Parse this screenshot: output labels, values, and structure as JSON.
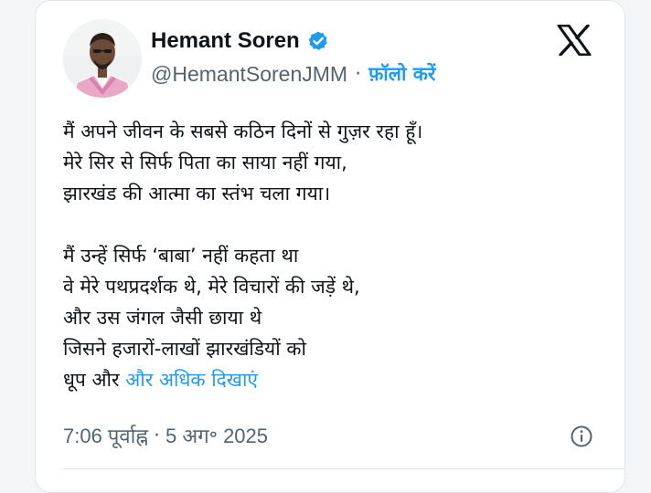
{
  "author": {
    "name": "Hemant Soren",
    "handle": "@HemantSorenJMM",
    "separator": "·",
    "follow_label": "फ़ॉलो करें",
    "verified_color": "#1d9bf0"
  },
  "tweet": {
    "lines": [
      "मैं अपने जीवन के सबसे कठिन दिनों से गुज़र रहा हूँ।",
      "मेरे सिर से सिर्फ पिता का साया नहीं गया,",
      "झारखंड की आत्मा का स्तंभ चला गया।",
      "",
      "मैं उन्हें सिर्फ ‘बाबा’ नहीं कहता था",
      "वे मेरे पथप्रदर्शक थे, मेरे विचारों की जड़ें थे,",
      "और उस जंगल जैसी छाया थे",
      "जिसने हजारों-लाखों झारखंडियों को"
    ],
    "last_line_prefix": "धूप और ",
    "show_more_label": "और अधिक दिखाएं"
  },
  "meta": {
    "time": "7:06 पूर्वाह्न",
    "separator": "·",
    "date": "5 अग॰ 2025"
  },
  "icons": {
    "avatar": "profile-photo",
    "verified": "verified-badge-icon",
    "logo": "x-logo-icon",
    "info": "info-icon"
  },
  "colors": {
    "link": "#1d9bf0",
    "text": "#0f1419",
    "secondary": "#536471"
  }
}
